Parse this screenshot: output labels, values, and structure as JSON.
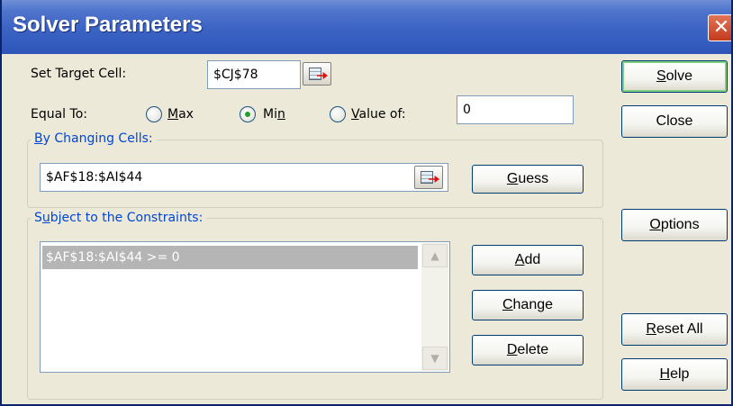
{
  "dialog": {
    "title": "Solver Parameters",
    "close_glyph": "✕"
  },
  "target": {
    "label_pre": "Set Target Cell:",
    "value": "$CJ$78"
  },
  "equal_to": {
    "label": "Equal To:",
    "options": [
      {
        "pre": "",
        "key": "M",
        "post": "ax",
        "selected": false
      },
      {
        "pre": "Mi",
        "key": "n",
        "post": "",
        "selected": true
      },
      {
        "pre": "",
        "key": "V",
        "post": "alue of:",
        "selected": false
      }
    ],
    "value_of": "0"
  },
  "changing": {
    "label_key": "B",
    "label_rest": "y Changing Cells:",
    "value": "$AF$18:$AI$44"
  },
  "constraints": {
    "label_pre": "S",
    "label_key": "u",
    "label_post": "bject to the Constraints:",
    "items": [
      "$AF$18:$AI$44 >= 0"
    ]
  },
  "buttons": {
    "solve": {
      "key": "S",
      "rest": "olve"
    },
    "close": {
      "pre": "Close"
    },
    "guess": {
      "key": "G",
      "rest": "uess"
    },
    "options": {
      "key": "O",
      "rest": "ptions"
    },
    "add": {
      "key": "A",
      "rest": "dd"
    },
    "change": {
      "key": "C",
      "rest": "hange"
    },
    "delete": {
      "key": "D",
      "rest": "elete"
    },
    "reset": {
      "key": "R",
      "rest": "eset All"
    },
    "help": {
      "key": "H",
      "rest": "elp"
    }
  },
  "icons": {
    "refedit": "range-selector-icon",
    "scroll_up": "▲",
    "scroll_down": "▼"
  },
  "colors": {
    "titlebar": "#3b63c4",
    "close_button": "#c43b1c",
    "dialog_bg": "#ece9d8",
    "radio_selected": "#21a121",
    "group_label": "#0046d5",
    "selected_row": "#b5b5b5"
  }
}
